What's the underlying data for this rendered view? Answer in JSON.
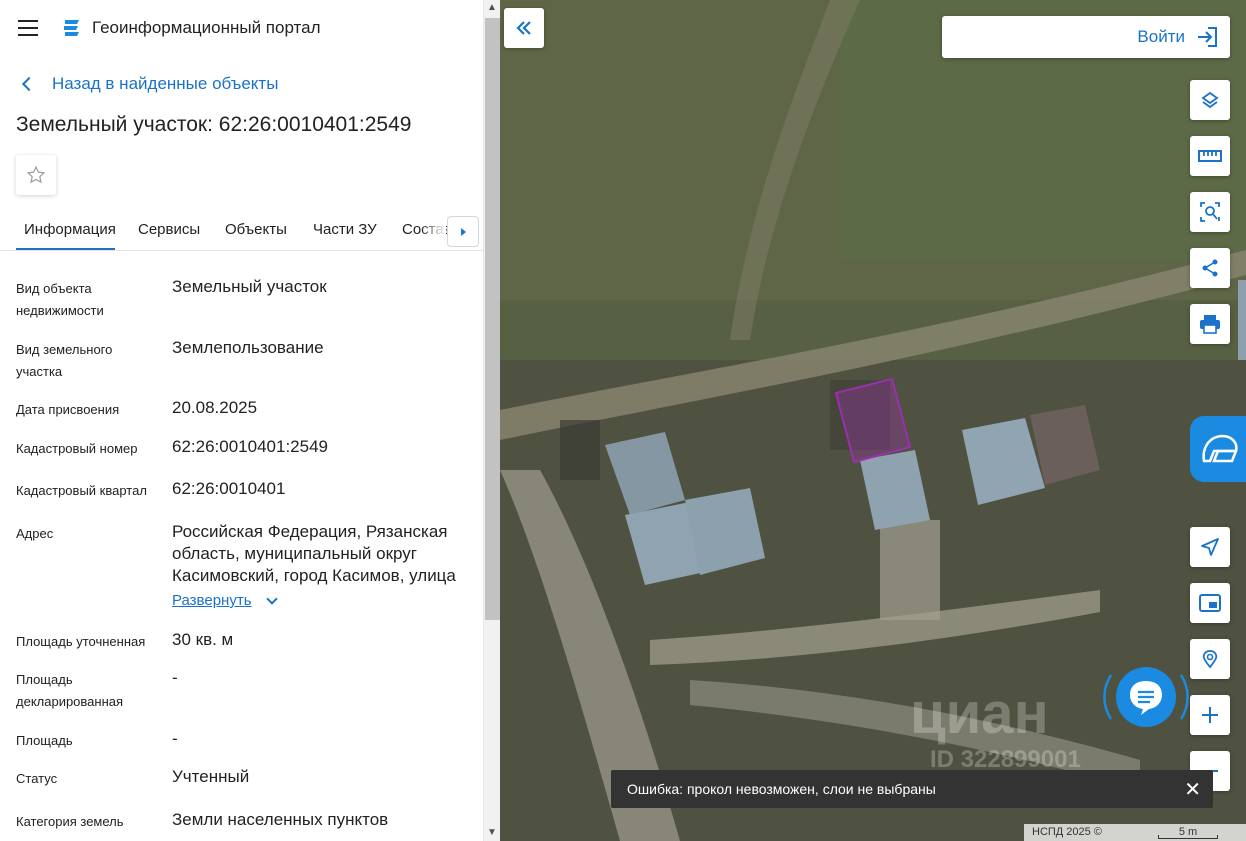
{
  "header": {
    "title": "Геоинформационный портал"
  },
  "back_link": "Назад в найденные объекты",
  "object_title": "Земельный участок: 62:26:0010401:2549",
  "tabs": [
    "Информация",
    "Сервисы",
    "Объекты",
    "Части ЗУ",
    "Состав"
  ],
  "fields": [
    {
      "label": "Вид объекта недвижимости",
      "value": "Земельный участок"
    },
    {
      "label": "Вид земельного участка",
      "value": "Землепользование"
    },
    {
      "label": "Дата присвоения",
      "value": "20.08.2025"
    },
    {
      "label": "Кадастровый номер",
      "value": "62:26:0010401:2549"
    },
    {
      "label": "Кадастровый квартал",
      "value": "62:26:0010401"
    },
    {
      "label": "Адрес",
      "value": "Российская Федерация, Рязанская область, муниципальный округ Касимовский, город Касимов, улица"
    },
    {
      "label": "Площадь уточненная",
      "value": "30 кв. м"
    },
    {
      "label": "Площадь декларированная",
      "value": "-"
    },
    {
      "label": "Площадь",
      "value": "-"
    },
    {
      "label": "Статус",
      "value": "Учтенный"
    },
    {
      "label": "Категория земель",
      "value": "Земли населенных пунктов"
    }
  ],
  "expand_label": "Развернуть",
  "map": {
    "login_label": "Войти",
    "toast": "Ошибка: прокол невозможен, слои не выбраны",
    "attribution": "НСПД 2025 ©",
    "scale": "5 m",
    "watermark_text": "циан",
    "watermark_id": "ID 322899001",
    "tools": [
      "layers-icon",
      "ruler-icon",
      "area-select-icon",
      "share-icon",
      "print-icon",
      "location-arrow-icon",
      "minimap-icon",
      "search-location-icon",
      "zoom-in-icon",
      "zoom-out-icon"
    ],
    "parcel_color": "#9b2fae",
    "accent": "#1a73c8"
  }
}
